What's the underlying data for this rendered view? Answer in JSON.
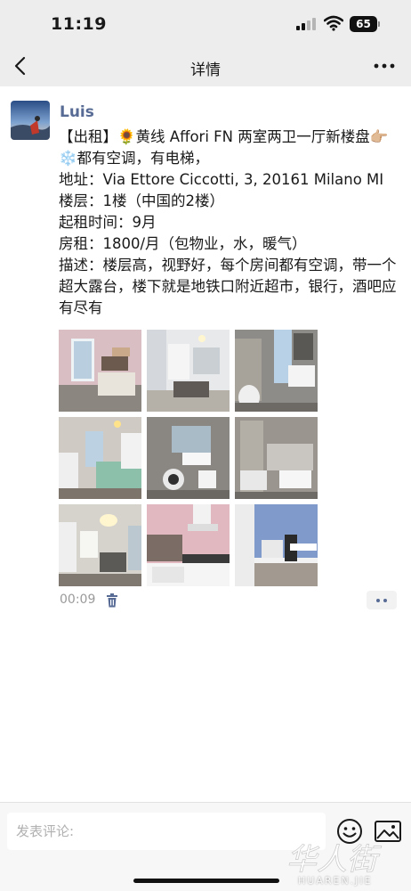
{
  "status_bar": {
    "time": "11:19",
    "battery": "65",
    "icons": [
      "signal-icon",
      "wifi-icon",
      "battery-icon"
    ]
  },
  "nav": {
    "title": "详情",
    "back_icon": "chevron-left-icon",
    "more_icon": "more-dots-icon"
  },
  "post": {
    "author": "Luis",
    "lines": [
      "【出租】🌻黄线 Affori FN 两室两卫一厅新楼盘👉🏼",
      "❄️都有空调，有电梯，",
      "地址：Via Ettore Ciccotti, 3, 20161 Milano MI",
      "楼层：1楼（中国的2楼）",
      "起租时间：9月",
      "房租：1800/月（包物业，水，暖气）",
      "描述：楼层高，视野好，每个房间都有空调，带一个超大露台，楼下就是地铁口附近超市，银行，酒吧应有尽有"
    ],
    "photo_count": 9,
    "time": "00:09",
    "delete_icon": "trash-icon",
    "action_icon": "more-actions-icon"
  },
  "comment_bar": {
    "placeholder": "发表评论:",
    "emoji_icon": "emoji-icon",
    "image_icon": "image-icon"
  },
  "watermark": {
    "text": "HUAREN.JIE"
  },
  "colors": {
    "link": "#576b95",
    "header_bg": "#ededed",
    "muted": "#9a9a9a"
  }
}
